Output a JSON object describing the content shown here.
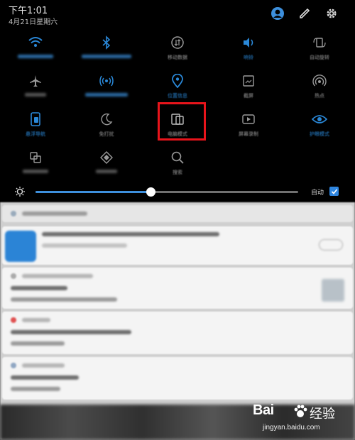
{
  "status_bar": {
    "time": "下午1:01",
    "date": "4月21日星期六",
    "icons": [
      "account-icon",
      "edit-icon",
      "settings-icon"
    ]
  },
  "quick_settings": {
    "row1": [
      {
        "icon": "wifi-icon",
        "label": "",
        "active": true
      },
      {
        "icon": "bluetooth-icon",
        "label": "",
        "active": true
      },
      {
        "icon": "mobile-data-icon",
        "label": "移动数据",
        "active": false
      },
      {
        "icon": "sound-icon",
        "label": "响铃",
        "active": true
      },
      {
        "icon": "auto-rotate-icon",
        "label": "自动旋转",
        "active": false
      }
    ],
    "row2": [
      {
        "icon": "airplane-icon",
        "label": "",
        "active": false
      },
      {
        "icon": "hotspot-signal-icon",
        "label": "",
        "active": true
      },
      {
        "icon": "location-icon",
        "label": "位置信息",
        "active": true
      },
      {
        "icon": "screenshot-icon",
        "label": "截屏",
        "active": false
      },
      {
        "icon": "hotspot-icon",
        "label": "热点",
        "active": false
      }
    ],
    "row3": [
      {
        "icon": "navigation-bar-icon",
        "label": "悬浮导航",
        "active": true
      },
      {
        "icon": "moon-icon",
        "label": "免打扰",
        "active": false
      },
      {
        "icon": "pc-mode-icon",
        "label": "电脑模式",
        "active": false
      },
      {
        "icon": "screen-record-icon",
        "label": "屏幕录制",
        "active": false
      },
      {
        "icon": "eye-comfort-icon",
        "label": "护眼模式",
        "active": true
      }
    ],
    "row4": [
      {
        "icon": "multi-screen-icon",
        "label": "",
        "active": false
      },
      {
        "icon": "nfc-icon",
        "label": "",
        "active": false
      },
      {
        "icon": "search-icon",
        "label": "搜索",
        "active": false
      }
    ]
  },
  "brightness": {
    "level": 0.44,
    "auto_label": "自动",
    "auto_checked": true
  },
  "colors": {
    "accent": "#2a88d8",
    "highlight": "#e8141b"
  },
  "watermark": {
    "logo_text": "Bai",
    "logo_text_cn": "经验",
    "url": "jingyan.baidu.com"
  }
}
